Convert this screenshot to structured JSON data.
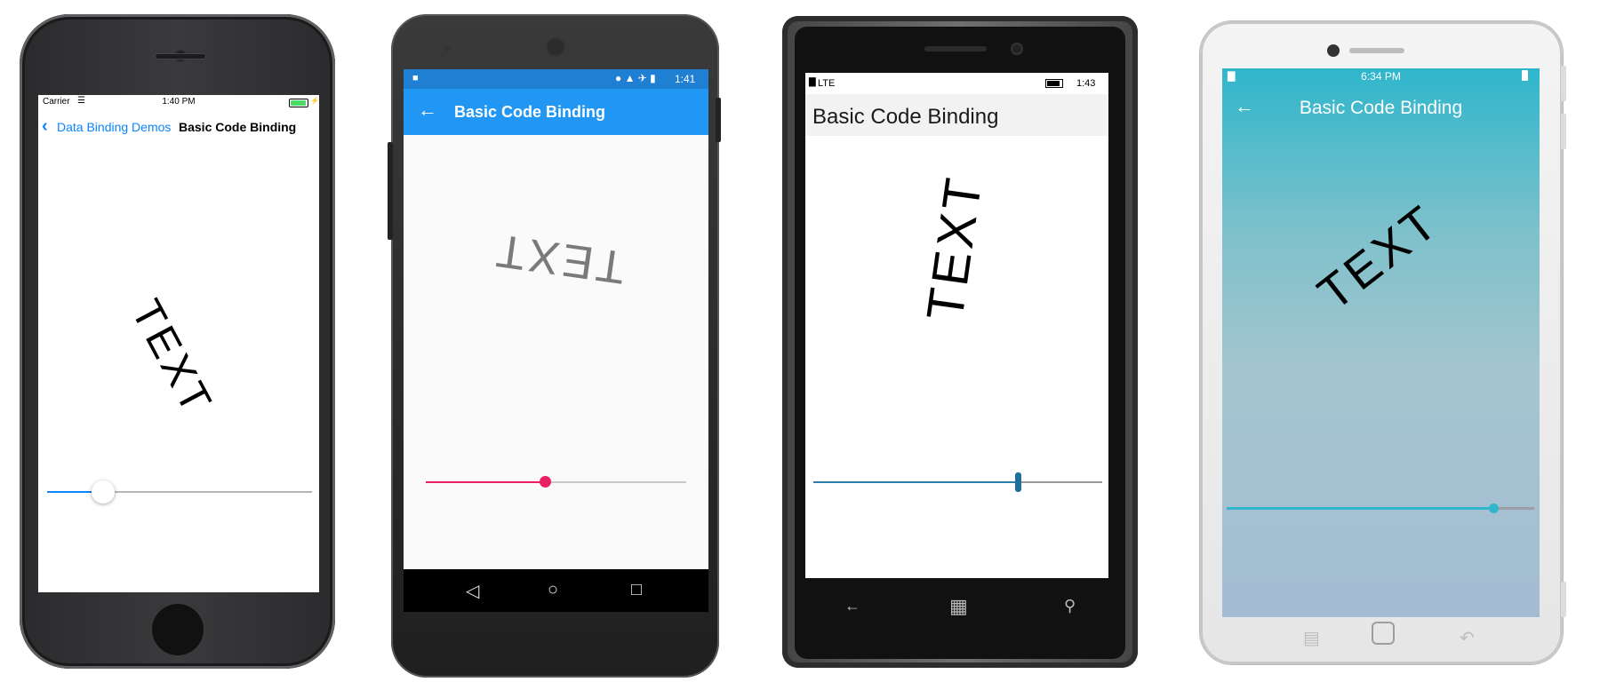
{
  "ios": {
    "carrier": "Carrier",
    "time": "1:40 PM",
    "back_label": "Data Binding Demos",
    "title": "Basic Code Binding",
    "rotated_text": "TEXT",
    "slider_value_fraction": 0.2
  },
  "android": {
    "status_time": "1:41",
    "title": "Basic Code Binding",
    "rotated_text": "TEXT",
    "slider_value_fraction": 0.46,
    "accent_color": "#e91e63",
    "toolbar_color": "#2196f3"
  },
  "windows_phone": {
    "network": "LTE",
    "status_time": "1:43",
    "title": "Basic Code Binding",
    "rotated_text": "TEXT",
    "slider_value_fraction": 0.71,
    "accent_color": "#2a7fae"
  },
  "tizen": {
    "status_time": "6:34 PM",
    "title": "Basic Code Binding",
    "rotated_text": "TEXT",
    "slider_value_fraction": 0.89,
    "accent_color": "#2fb6cb"
  },
  "icons": {
    "back_chevron": "chevron-left-icon",
    "back_arrow": "arrow-left-icon",
    "nav_back": "triangle-back-icon",
    "nav_home": "circle-home-icon",
    "nav_recents": "square-recents-icon",
    "windows_logo": "windows-logo-icon",
    "search": "search-icon"
  }
}
